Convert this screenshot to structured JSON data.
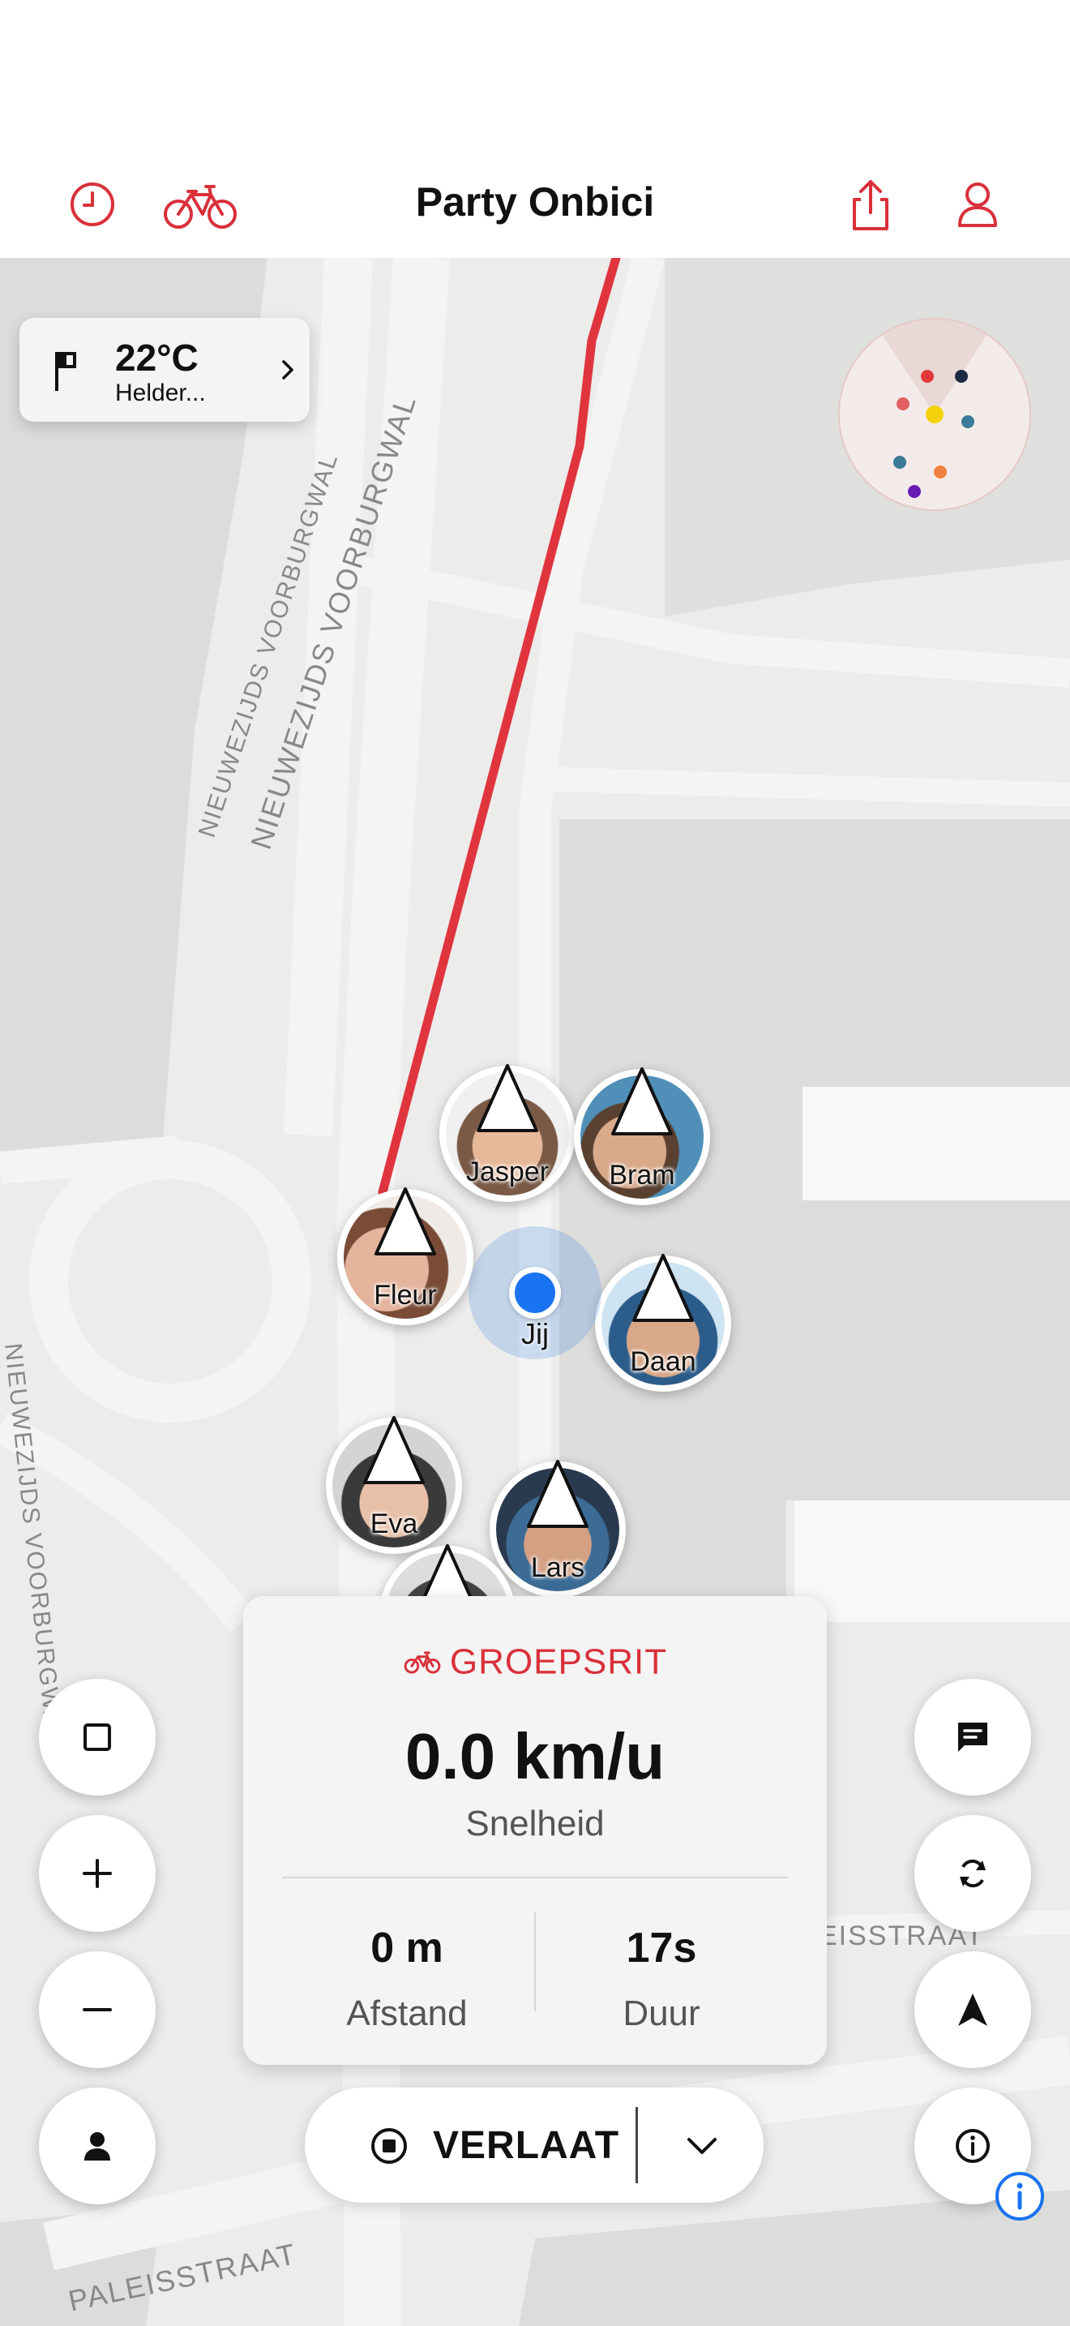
{
  "header": {
    "title": "Party Onbici",
    "icons": [
      "history-icon",
      "bike-icon",
      "share-icon",
      "profile-icon"
    ],
    "accent_color": "#d9303a"
  },
  "weather": {
    "temperature": "22°C",
    "condition": "Helder..."
  },
  "map": {
    "street_labels": [
      "NIEUWEZIJDS VOORBURGWAL",
      "NIEUWEZIJDS VOORBURGWAL",
      "NIEUWEZIJDS VOORBURGWAL",
      "PALEISSTRAAT",
      "EISSTRAAT"
    ],
    "route_color": "#e0353f"
  },
  "riders": [
    {
      "name": "Jasper"
    },
    {
      "name": "Bram"
    },
    {
      "name": "Fleur"
    },
    {
      "name": "Daan"
    },
    {
      "name": "Eva"
    },
    {
      "name": "Lars"
    }
  ],
  "self_label": "Jij",
  "ride_card": {
    "mode": "GROEPSRIT",
    "speed": "0.0 km/u",
    "speed_label": "Snelheid",
    "distance": "0 m",
    "distance_label": "Afstand",
    "duration": "17s",
    "duration_label": "Duur"
  },
  "leave_button": {
    "label": "VERLAAT"
  }
}
